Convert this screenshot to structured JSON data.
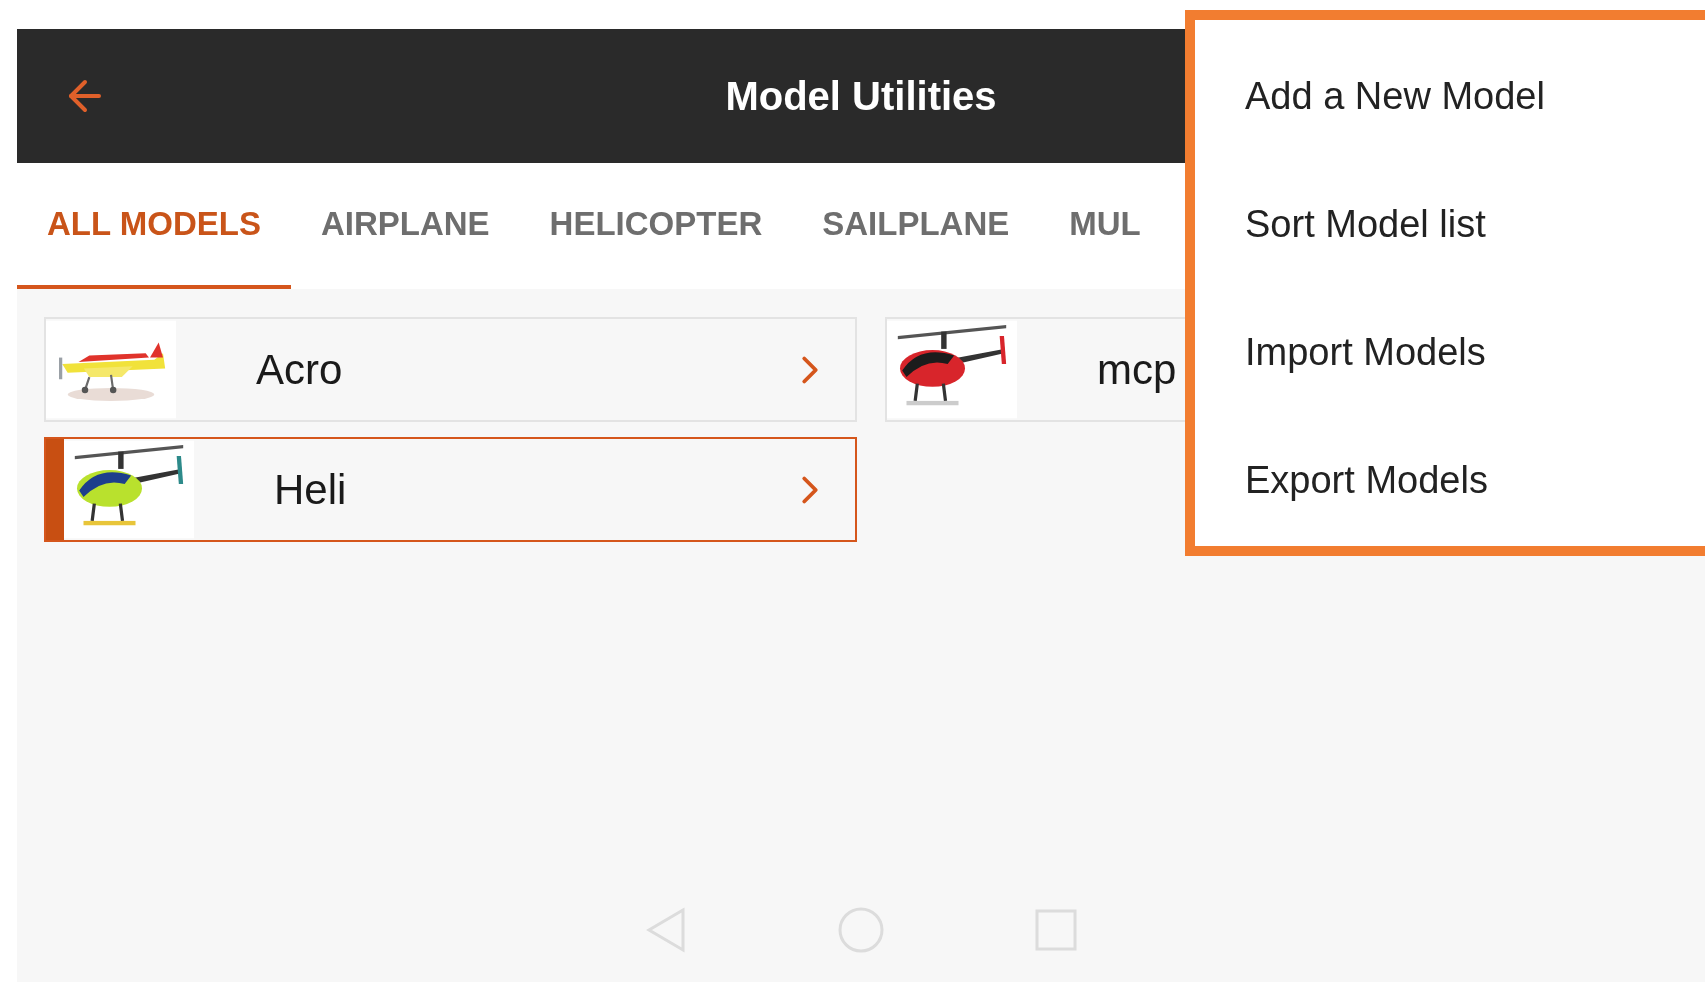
{
  "header": {
    "title": "Model Utilities"
  },
  "tabs": [
    {
      "label": "ALL MODELS",
      "selected": true
    },
    {
      "label": "AIRPLANE",
      "selected": false
    },
    {
      "label": "HELICOPTER",
      "selected": false
    },
    {
      "label": "SAILPLANE",
      "selected": false
    },
    {
      "label": "MUL",
      "selected": false
    }
  ],
  "models": [
    {
      "name": "Acro",
      "selected": false
    },
    {
      "name": "mcp",
      "selected": false
    },
    {
      "name": "Heli",
      "selected": true
    }
  ],
  "menu": {
    "items": [
      "Add a New Model",
      "Sort Model list",
      "Import Models",
      "Export Models"
    ]
  }
}
